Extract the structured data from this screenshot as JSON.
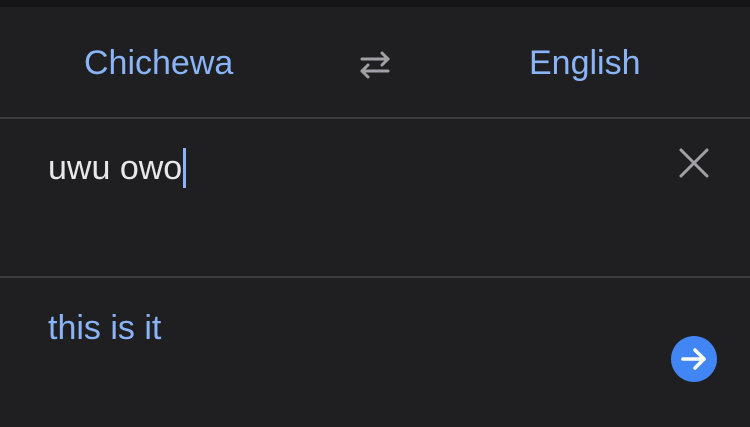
{
  "languages": {
    "source": "Chichewa",
    "target": "English",
    "swap_icon": "swap-arrows-icon"
  },
  "input": {
    "text": "uwu owo",
    "clear_icon": "close-icon"
  },
  "output": {
    "text": "this is it",
    "go_icon": "arrow-right-icon"
  },
  "colors": {
    "background": "#1f1f22",
    "accent": "#8ab4f8",
    "button": "#4285f4",
    "divider": "#3c3c40",
    "text": "#e8e8ea"
  }
}
